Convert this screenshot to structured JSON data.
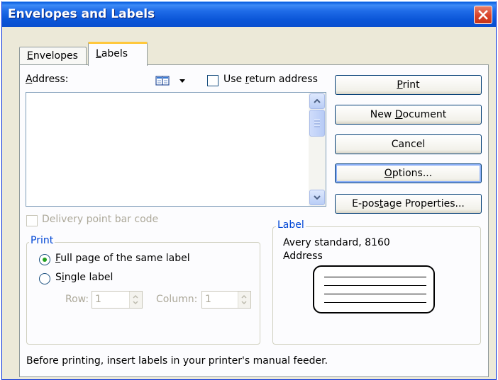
{
  "window": {
    "title": "Envelopes and Labels"
  },
  "tabs": [
    {
      "label": "Envelopes",
      "mnemonic": "E",
      "rest": "nvelopes",
      "active": false
    },
    {
      "label": "Labels",
      "mnemonic": "L",
      "rest": "abels",
      "active": true
    }
  ],
  "address": {
    "label_mnemonic": "A",
    "label_rest": "ddress:",
    "value": "",
    "address_book_icon": "address-book-icon",
    "use_return_address": {
      "before": "Use ",
      "mnemonic": "r",
      "after": "eturn address",
      "checked": false
    }
  },
  "buttons": {
    "print": {
      "mnemonic": "P",
      "rest": "rint"
    },
    "new_document": {
      "before": "New ",
      "mnemonic": "D",
      "after": "ocument"
    },
    "cancel": {
      "label": "Cancel"
    },
    "options": {
      "mnemonic": "O",
      "rest": "ptions..."
    },
    "epostage": {
      "before": "E-pos",
      "mnemonic": "t",
      "after": "age Properties..."
    }
  },
  "delivery_point": {
    "label": "Delivery point bar code",
    "checked": false,
    "enabled": false
  },
  "print_group": {
    "title": "Print",
    "full_page": {
      "mnemonic": "F",
      "rest": "ull page of the same label",
      "selected": true
    },
    "single_label": {
      "before": "S",
      "mnemonic": "i",
      "after": "ngle label",
      "selected": false
    },
    "row": {
      "label": "Row:",
      "value": "1"
    },
    "column": {
      "label": "Column:",
      "value": "1"
    }
  },
  "label_group": {
    "title": "Label",
    "line1": "Avery standard, 8160",
    "line2": "Address"
  },
  "footer": {
    "hint": "Before printing, insert labels in your printer's manual feeder."
  },
  "colors": {
    "titlebar": "#0b56d8",
    "dialog_bg": "#ece9d8",
    "group_title": "#0046d5",
    "tab_highlight": "#ffc83c",
    "radio_dot": "#21a121"
  }
}
